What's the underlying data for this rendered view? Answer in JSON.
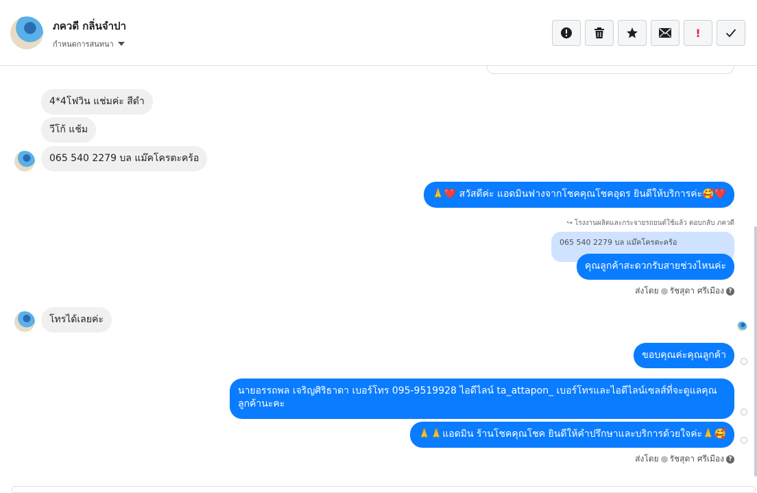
{
  "header": {
    "contact_name": "ภควดี กลิ่นจำปา",
    "conversation_settings": "กำหนดการสนทนา"
  },
  "toolbar": {
    "buttons": [
      {
        "name": "mark-spam",
        "icon": "alert-circle-icon"
      },
      {
        "name": "delete",
        "icon": "trash-icon"
      },
      {
        "name": "star",
        "icon": "star-icon"
      },
      {
        "name": "mark-unread",
        "icon": "envelope-icon"
      },
      {
        "name": "important",
        "icon": "exclamation-icon",
        "label": "!"
      },
      {
        "name": "done",
        "icon": "checkmark-icon"
      }
    ]
  },
  "messages": {
    "in1": "4*4โฟวิน แช่มค่ะ สีดำ",
    "in2": "วีโก้ แช้ม",
    "in3": "065 540 2279 บล แม๊คโครตะคร้อ",
    "out1": "🙏❤️ สวัสดีค่ะ แอดมินฟางจากโชคคุณโชคอุดร ยินดีให้บริการค่ะ🥰❤️",
    "reply_meta": "โรงงานผลิตและกระจายรถยนต์ใช้แล้ว ตอบกลับ ภควดี",
    "quoted": "065 540 2279 บล แม๊คโครตะคร้อ",
    "out2": "คุณลูกค้าสะดวกรับสายช่วงไหนค่ะ",
    "sent_by_label": "ส่งโดย",
    "sent_by_name": "รัชสุดา ศรีเมือง",
    "in4": "โทรได้เลยค่ะ",
    "out3": "ขอบคุณค่ะคุณลูกค้า",
    "out4": "นายอรรถพล เจริญศิริธาดา      เบอร์โทร 095-9519928 ไอดีไลน์ ta_attapon_   เบอร์โทรและไอดีไลน์เซลส์ที่จะดูแลคุณลูกค้านะคะ",
    "out5": "🙏🙏แอดมิน ร้านโชคคุณโชค ยินดีให้คำปรึกษาและบริการด้วยใจค่ะ🙏🥰",
    "sent_by_label2": "ส่งโดย",
    "sent_by_name2": "รัชสุดา ศรีเมือง"
  },
  "colors": {
    "outgoing_bubble": "#0a7cff",
    "incoming_bubble": "#f0f0f0",
    "quoted_bubble": "#cfe2ff"
  }
}
